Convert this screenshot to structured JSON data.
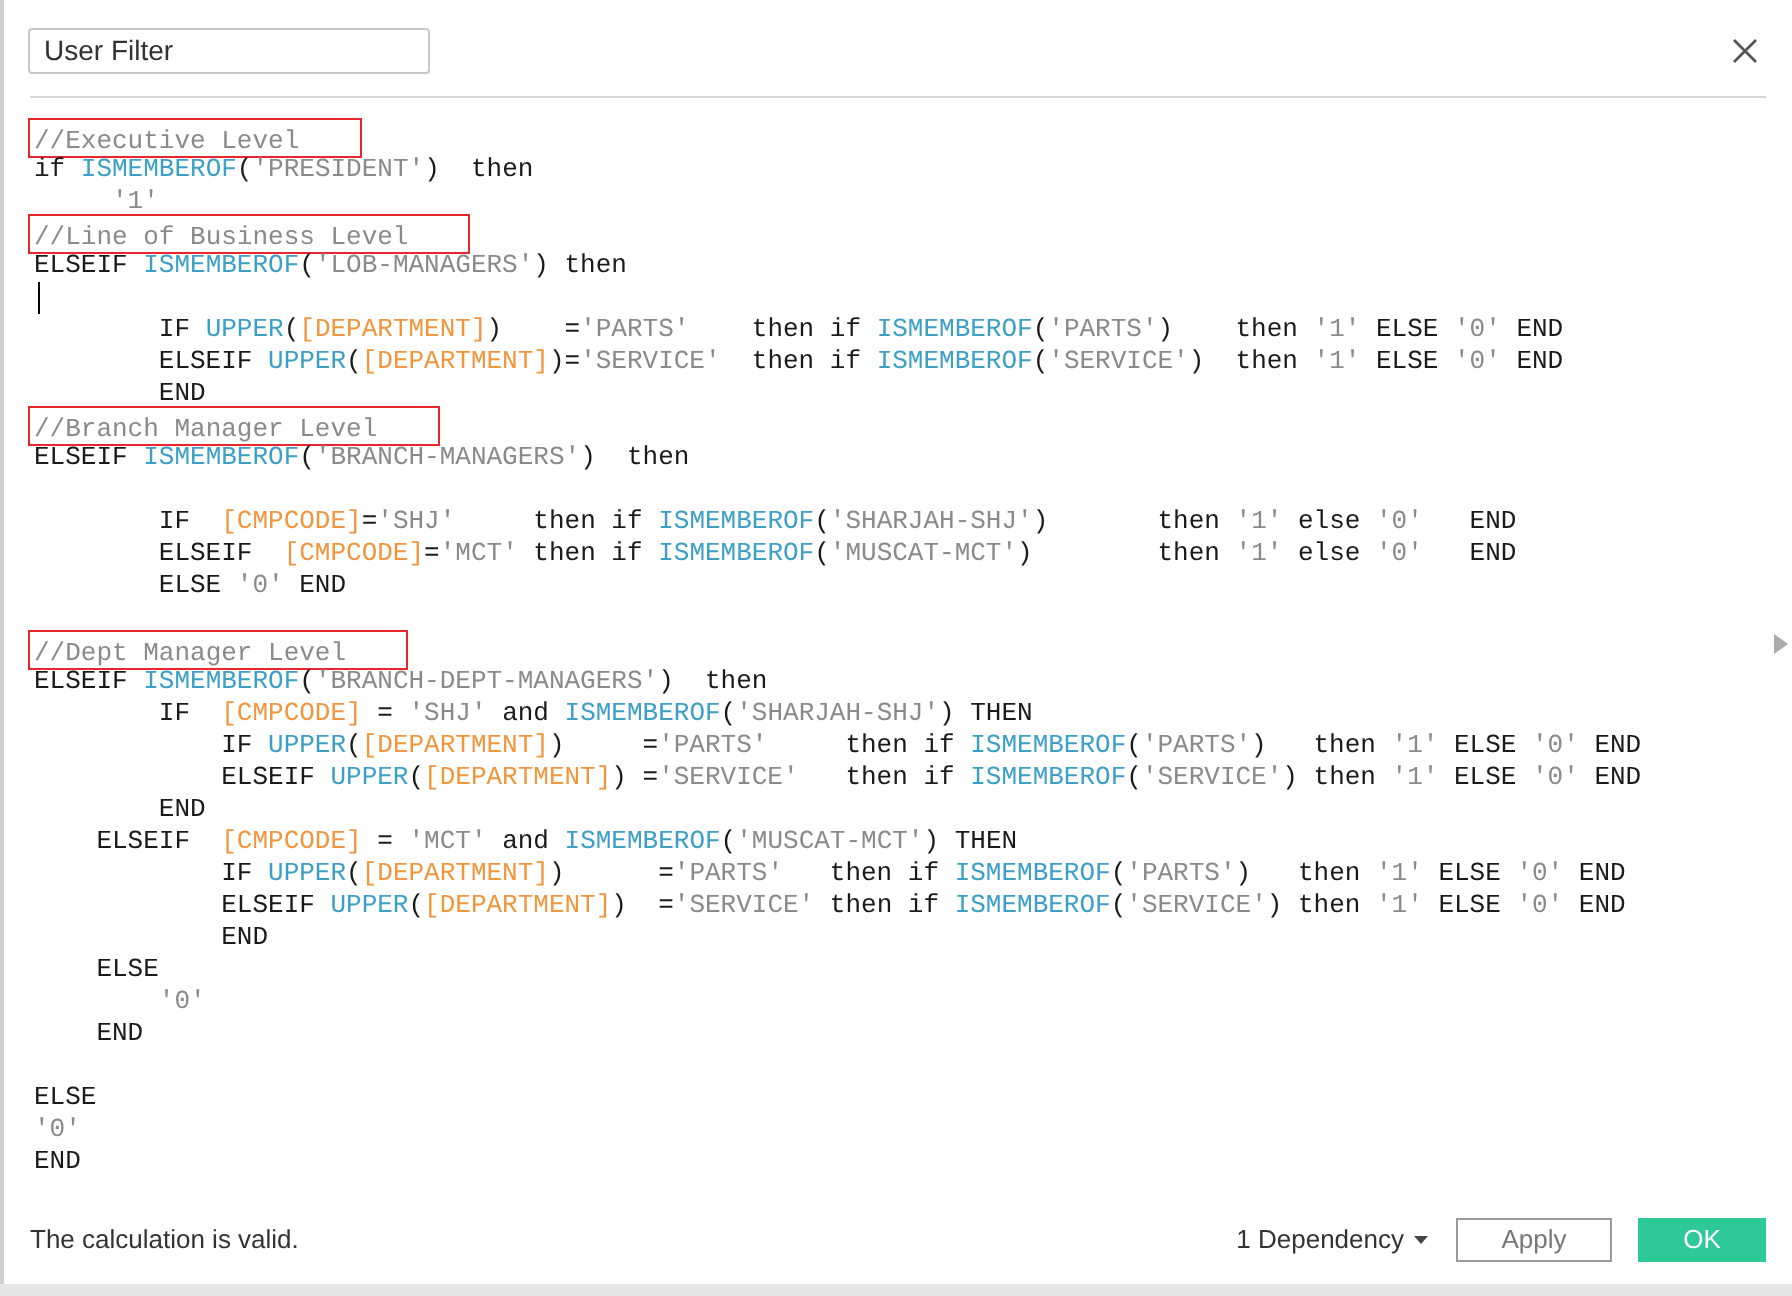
{
  "dialog": {
    "title_field": "User Filter",
    "code_lines": [
      {
        "kind": "comment",
        "boxed": true,
        "text": "//Executive Level"
      },
      {
        "kind": "code",
        "text": "if ISMEMBEROF('PRESIDENT')  then"
      },
      {
        "kind": "code",
        "text": "     '1'"
      },
      {
        "kind": "comment",
        "boxed": true,
        "text": "//Line of Business Level"
      },
      {
        "kind": "code",
        "text": "ELSEIF ISMEMBEROF('LOB-MANAGERS') then"
      },
      {
        "kind": "blank",
        "cursor": true
      },
      {
        "kind": "code",
        "text": "        IF UPPER([DEPARTMENT])    ='PARTS'    then if ISMEMBEROF('PARTS')    then '1' ELSE '0' END"
      },
      {
        "kind": "code",
        "text": "        ELSEIF UPPER([DEPARTMENT])='SERVICE'  then if ISMEMBEROF('SERVICE')  then '1' ELSE '0' END"
      },
      {
        "kind": "code",
        "text": "        END"
      },
      {
        "kind": "comment",
        "boxed": true,
        "text": "//Branch Manager Level"
      },
      {
        "kind": "code",
        "text": "ELSEIF ISMEMBEROF('BRANCH-MANAGERS')  then"
      },
      {
        "kind": "blank"
      },
      {
        "kind": "code",
        "text": "        IF  [CMPCODE]='SHJ'     then if ISMEMBEROF('SHARJAH-SHJ')       then '1' else '0'   END"
      },
      {
        "kind": "code",
        "text": "        ELSEIF  [CMPCODE]='MCT' then if ISMEMBEROF('MUSCAT-MCT')        then '1' else '0'   END"
      },
      {
        "kind": "code",
        "text": "        ELSE '0' END"
      },
      {
        "kind": "blank"
      },
      {
        "kind": "comment",
        "boxed": true,
        "text": "//Dept Manager Level"
      },
      {
        "kind": "code",
        "text": "ELSEIF ISMEMBEROF('BRANCH-DEPT-MANAGERS')  then"
      },
      {
        "kind": "code",
        "text": "        IF  [CMPCODE] = 'SHJ' and ISMEMBEROF('SHARJAH-SHJ') THEN"
      },
      {
        "kind": "code",
        "text": "            IF UPPER([DEPARTMENT])     ='PARTS'     then if ISMEMBEROF('PARTS')   then '1' ELSE '0' END"
      },
      {
        "kind": "code",
        "text": "            ELSEIF UPPER([DEPARTMENT]) ='SERVICE'   then if ISMEMBEROF('SERVICE') then '1' ELSE '0' END"
      },
      {
        "kind": "code",
        "text": "        END"
      },
      {
        "kind": "code",
        "text": "    ELSEIF  [CMPCODE] = 'MCT' and ISMEMBEROF('MUSCAT-MCT') THEN"
      },
      {
        "kind": "code",
        "text": "            IF UPPER([DEPARTMENT])      ='PARTS'   then if ISMEMBEROF('PARTS')   then '1' ELSE '0' END"
      },
      {
        "kind": "code",
        "text": "            ELSEIF UPPER([DEPARTMENT])  ='SERVICE' then if ISMEMBEROF('SERVICE') then '1' ELSE '0' END"
      },
      {
        "kind": "code",
        "text": "            END"
      },
      {
        "kind": "code",
        "text": "    ELSE"
      },
      {
        "kind": "code",
        "text": "        '0'"
      },
      {
        "kind": "code",
        "text": "    END"
      },
      {
        "kind": "blank"
      },
      {
        "kind": "code",
        "text": "ELSE"
      },
      {
        "kind": "code",
        "text": "'0'"
      },
      {
        "kind": "code",
        "text": "END"
      }
    ],
    "status": "The calculation is valid.",
    "dependency_button": "1 Dependency",
    "buttons": [
      {
        "kind": "secondary",
        "label": "Apply"
      },
      {
        "kind": "primary",
        "label": "OK"
      }
    ]
  }
}
